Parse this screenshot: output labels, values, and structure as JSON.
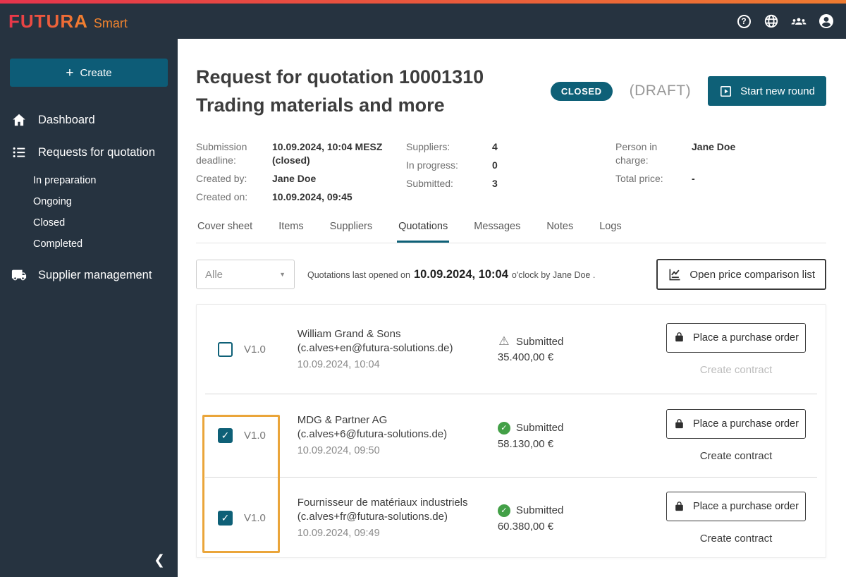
{
  "colors": {
    "accent_teal": "#0E6077",
    "navy": "#263340",
    "brand_gradient_start": "#E8344A",
    "brand_gradient_end": "#F0832E",
    "highlight_orange": "#EAA53A",
    "status_green": "#43A047",
    "status_warning_gray": "#757575"
  },
  "topbar": {
    "brand": "FUTURA",
    "brand_suffix": "Smart"
  },
  "sidebar": {
    "create_label": "Create",
    "items": [
      {
        "label": "Dashboard"
      },
      {
        "label": "Requests for quotation"
      },
      {
        "label": "Supplier management"
      }
    ],
    "sub_items": [
      {
        "label": "In preparation"
      },
      {
        "label": "Ongoing"
      },
      {
        "label": "Closed"
      },
      {
        "label": "Completed"
      }
    ],
    "collapse_glyph": "❮"
  },
  "header": {
    "title_line1": "Request for quotation 10001310",
    "title_line2": "Trading materials and more",
    "status_badge": "CLOSED",
    "draft_label": "(DRAFT)",
    "start_new_round_label": "Start new round"
  },
  "meta": {
    "col1": [
      {
        "label": "Submission deadline:",
        "value": "10.09.2024, 10:04 MESZ (closed)"
      },
      {
        "label": "Created by:",
        "value": "Jane Doe"
      },
      {
        "label": "Created on:",
        "value": "10.09.2024, 09:45"
      }
    ],
    "col2": [
      {
        "label": "Suppliers:",
        "value": "4"
      },
      {
        "label": "In progress:",
        "value": "0"
      },
      {
        "label": "Submitted:",
        "value": "3"
      }
    ],
    "col3": [
      {
        "label": "Person in charge:",
        "value": "Jane Doe"
      },
      {
        "label": "Total price:",
        "value": "-"
      }
    ]
  },
  "tabs": {
    "items": [
      {
        "label": "Cover sheet",
        "active": false
      },
      {
        "label": "Items",
        "active": false
      },
      {
        "label": "Suppliers",
        "active": false
      },
      {
        "label": "Quotations",
        "active": true
      },
      {
        "label": "Messages",
        "active": false
      },
      {
        "label": "Notes",
        "active": false
      },
      {
        "label": "Logs",
        "active": false
      }
    ]
  },
  "filter": {
    "dropdown_value": "Alle",
    "note_prefix": "Quotations last opened on",
    "note_date": "10.09.2024, 10:04",
    "note_suffix": "o'clock by Jane Doe ."
  },
  "toolbar": {
    "price_comparison_label": "Open price comparison list"
  },
  "quotations": {
    "rows": [
      {
        "checked": false,
        "version": "V1.0",
        "name": "William Grand & Sons",
        "email": "(c.alves+en@futura-solutions.de)",
        "date": "10.09.2024, 10:04",
        "status_icon": "warning",
        "status": "Submitted",
        "amount": "35.400,00 €",
        "order_label": "Place a purchase order",
        "contract_label": "Create contract",
        "contract_enabled": false
      },
      {
        "checked": true,
        "version": "V1.0",
        "name": "MDG & Partner AG",
        "email": "(c.alves+6@futura-solutions.de)",
        "date": "10.09.2024, 09:50",
        "status_icon": "success",
        "status": "Submitted",
        "amount": "58.130,00 €",
        "order_label": "Place a purchase order",
        "contract_label": "Create contract",
        "contract_enabled": true
      },
      {
        "checked": true,
        "version": "V1.0",
        "name": "Fournisseur de matériaux industriels",
        "email": "(c.alves+fr@futura-solutions.de)",
        "date": "10.09.2024, 09:49",
        "status_icon": "success",
        "status": "Submitted",
        "amount": "60.380,00 €",
        "order_label": "Place a purchase order",
        "contract_label": "Create contract",
        "contract_enabled": true
      }
    ]
  }
}
